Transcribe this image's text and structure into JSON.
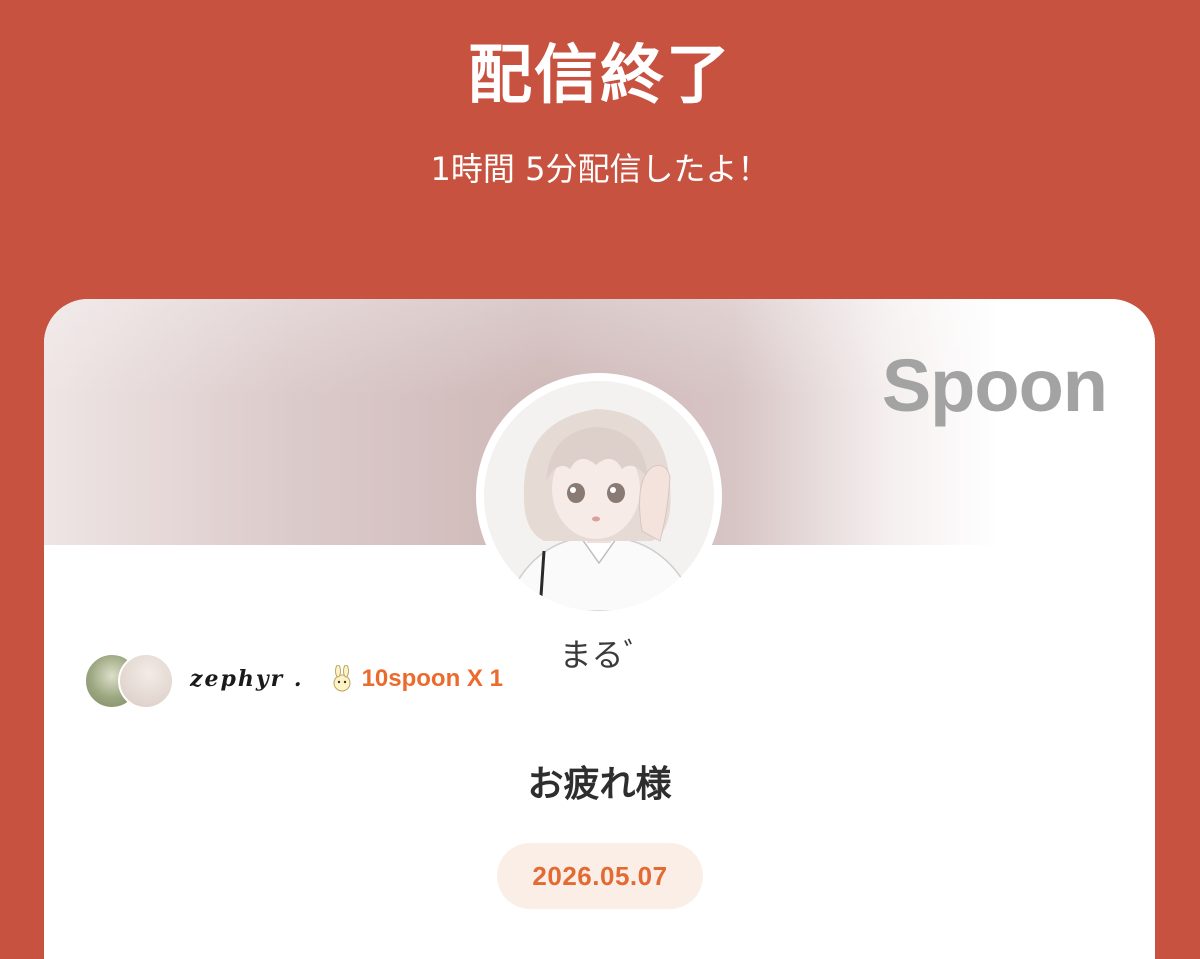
{
  "header": {
    "title": "配信終了",
    "subtitle": "1時間 5分配信したよ！"
  },
  "card": {
    "brand": "Spoon",
    "host": {
      "name": "まるﾞ"
    },
    "top_listener": {
      "name": "zephyr .",
      "gift": "10spoon X 1"
    },
    "message": "お疲れ様",
    "date": "2026.05.07"
  },
  "colors": {
    "background": "#c85240",
    "gift_accent": "#ea6b2c",
    "date_text": "#e46a33",
    "date_pill": "#fbeee7",
    "brand_gray": "#a3a3a3"
  }
}
